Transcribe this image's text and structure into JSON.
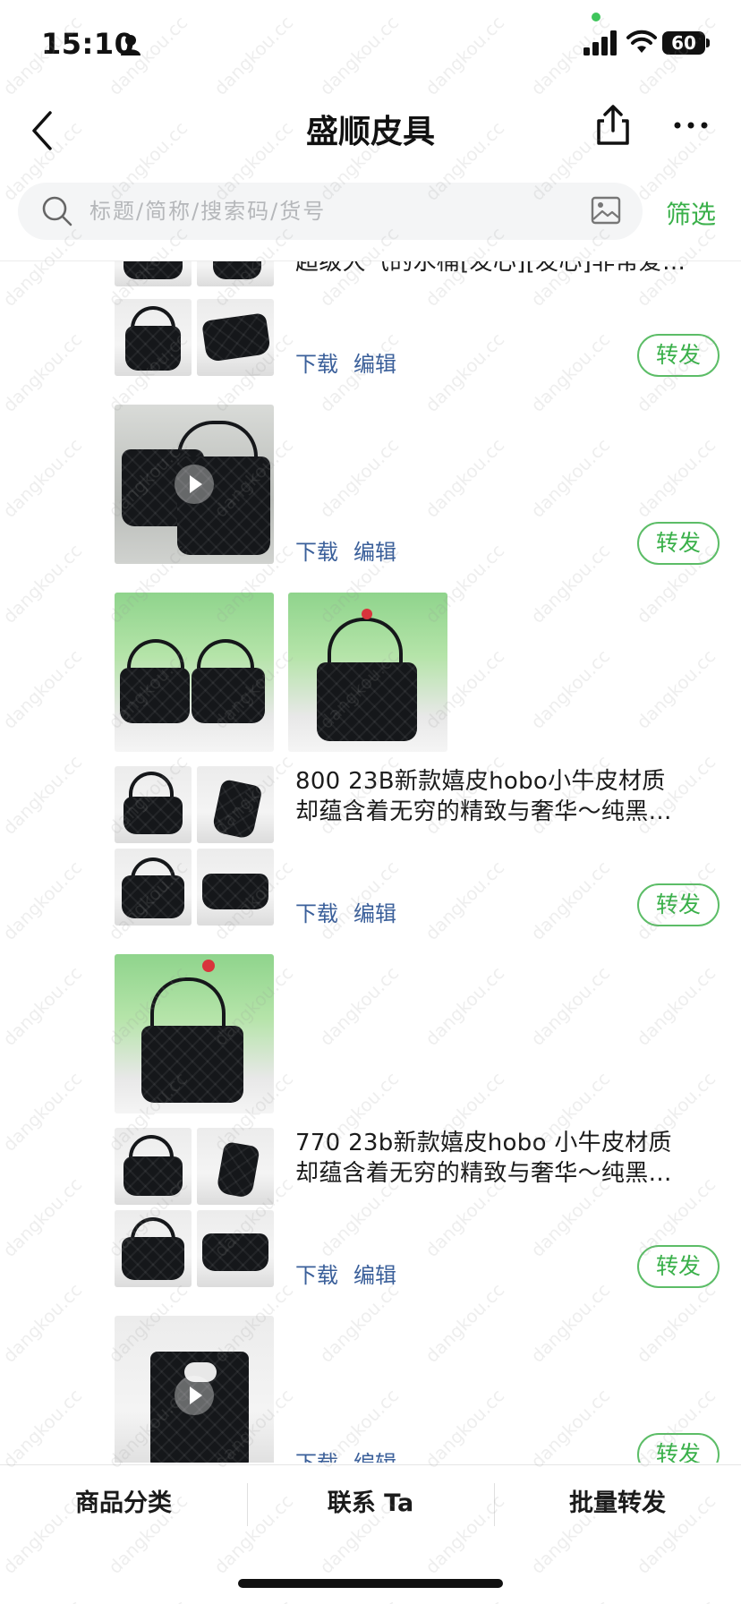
{
  "status_bar": {
    "time": "15:10",
    "battery": "60"
  },
  "nav": {
    "title": "盛顺皮具"
  },
  "search": {
    "placeholder": "标题/简称/搜索码/货号",
    "filter_label": "筛选"
  },
  "items": [
    {
      "text_line1": "超级大气的水桶[发心][发心]非常爱…",
      "text_line2": "",
      "download_label": "下载",
      "edit_label": "编辑",
      "forward_label": "转发"
    },
    {
      "text_line1": "",
      "text_line2": "",
      "download_label": "下载",
      "edit_label": "编辑",
      "forward_label": "转发",
      "is_video": true
    },
    {
      "text_line1": "800   23B新款嬉皮hobo小牛皮材质",
      "text_line2": "却蕴含着无穷的精致与奢华～纯黑…",
      "download_label": "下载",
      "edit_label": "编辑",
      "forward_label": "转发"
    },
    {
      "text_line1": "770   23b新款嬉皮hobo 小牛皮材质",
      "text_line2": "却蕴含着无穷的精致与奢华～纯黑…",
      "download_label": "下载",
      "edit_label": "编辑",
      "forward_label": "转发"
    },
    {
      "text_line1": "",
      "text_line2": "",
      "download_label": "下载",
      "edit_label": "编辑",
      "forward_label": "转发",
      "is_video": true
    }
  ],
  "bottom_tabs": [
    "商品分类",
    "联系 Ta",
    "批量转发"
  ],
  "watermark": "dangkou.cc",
  "colors": {
    "accent_green": "#3ab04a",
    "link_blue": "#3a5f9a"
  }
}
